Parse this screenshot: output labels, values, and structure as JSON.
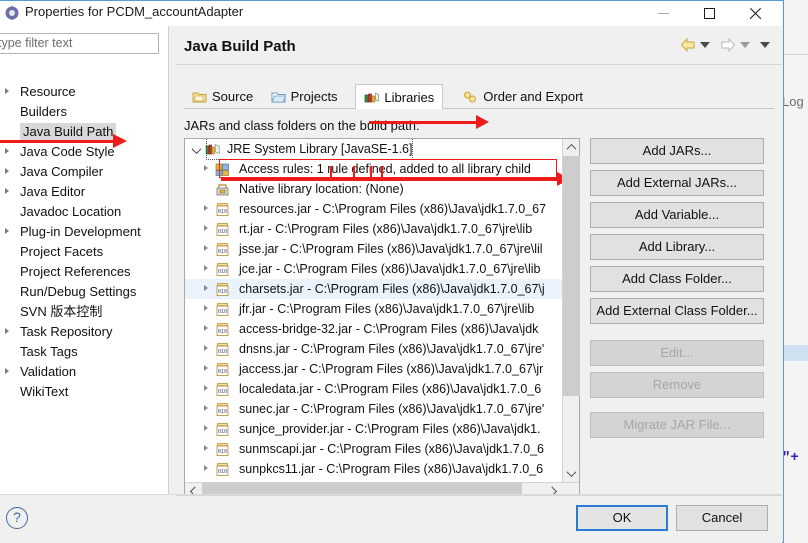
{
  "window": {
    "title": "Properties for PCDM_accountAdapter",
    "icon": "eclipse-properties-icon",
    "controls": {
      "minimize": "minimize-icon",
      "maximize": "maximize-icon",
      "close": "close-icon"
    }
  },
  "sidebar": {
    "filter": {
      "value": "",
      "placeholder": "type filter text"
    },
    "items": [
      {
        "label": "Resource",
        "expandable": true,
        "selected": false
      },
      {
        "label": "Builders",
        "expandable": false,
        "selected": false
      },
      {
        "label": "Java Build Path",
        "expandable": false,
        "selected": true
      },
      {
        "label": "Java Code Style",
        "expandable": true,
        "selected": false
      },
      {
        "label": "Java Compiler",
        "expandable": true,
        "selected": false
      },
      {
        "label": "Java Editor",
        "expandable": true,
        "selected": false
      },
      {
        "label": "Javadoc Location",
        "expandable": false,
        "selected": false
      },
      {
        "label": "Plug-in Development",
        "expandable": true,
        "selected": false
      },
      {
        "label": "Project Facets",
        "expandable": false,
        "selected": false
      },
      {
        "label": "Project References",
        "expandable": false,
        "selected": false
      },
      {
        "label": "Run/Debug Settings",
        "expandable": false,
        "selected": false
      },
      {
        "label": "SVN 版本控制",
        "expandable": false,
        "selected": false
      },
      {
        "label": "Task Repository",
        "expandable": true,
        "selected": false
      },
      {
        "label": "Task Tags",
        "expandable": false,
        "selected": false
      },
      {
        "label": "Validation",
        "expandable": true,
        "selected": false
      },
      {
        "label": "WikiText",
        "expandable": false,
        "selected": false
      }
    ]
  },
  "page": {
    "title": "Java Build Path",
    "nav": {
      "back_icon": "back-arrow-icon",
      "back_menu_icon": "chevron-down-icon",
      "forward_icon": "forward-arrow-icon",
      "forward_menu_icon": "chevron-down-icon",
      "menu_icon": "chevron-down-icon"
    },
    "tabs": [
      {
        "label": "Source",
        "icon": "source-folder-icon",
        "active": false
      },
      {
        "label": "Projects",
        "icon": "projects-folder-icon",
        "active": false
      },
      {
        "label": "Libraries",
        "icon": "libraries-books-icon",
        "active": true
      },
      {
        "label": "Order and Export",
        "icon": "order-export-icon",
        "active": false
      }
    ],
    "hint": "JARs and class folders on the build path:"
  },
  "tree": {
    "rows": [
      {
        "text": "JRE System Library [JavaSE-1.6]",
        "icon": "jre-library-icon",
        "expander": "down",
        "indent": 0,
        "hover": false,
        "focus": true
      },
      {
        "text": "Access rules: 1 rule defined, added to all library child",
        "icon": "access-rules-icon",
        "expander": "right",
        "indent": 1,
        "hover": false,
        "focus": false
      },
      {
        "text": "Native library location: (None)",
        "icon": "native-library-icon",
        "expander": "none",
        "indent": 1,
        "hover": false,
        "focus": false
      },
      {
        "text": "resources.jar - C:\\Program Files (x86)\\Java\\jdk1.7.0_67",
        "icon": "jar-icon",
        "expander": "right",
        "indent": 1,
        "hover": false,
        "focus": false
      },
      {
        "text": "rt.jar - C:\\Program Files (x86)\\Java\\jdk1.7.0_67\\jre\\lib",
        "icon": "jar-icon",
        "expander": "right",
        "indent": 1,
        "hover": false,
        "focus": false
      },
      {
        "text": "jsse.jar - C:\\Program Files (x86)\\Java\\jdk1.7.0_67\\jre\\lil",
        "icon": "jar-icon",
        "expander": "right",
        "indent": 1,
        "hover": false,
        "focus": false
      },
      {
        "text": "jce.jar - C:\\Program Files (x86)\\Java\\jdk1.7.0_67\\jre\\lib",
        "icon": "jar-icon",
        "expander": "right",
        "indent": 1,
        "hover": false,
        "focus": false
      },
      {
        "text": "charsets.jar - C:\\Program Files (x86)\\Java\\jdk1.7.0_67\\j",
        "icon": "jar-icon",
        "expander": "right",
        "indent": 1,
        "hover": true,
        "focus": false
      },
      {
        "text": "jfr.jar - C:\\Program Files (x86)\\Java\\jdk1.7.0_67\\jre\\lib",
        "icon": "jar-icon",
        "expander": "right",
        "indent": 1,
        "hover": false,
        "focus": false
      },
      {
        "text": "access-bridge-32.jar - C:\\Program Files (x86)\\Java\\jdk",
        "icon": "jar-icon",
        "expander": "right",
        "indent": 1,
        "hover": false,
        "focus": false
      },
      {
        "text": "dnsns.jar - C:\\Program Files (x86)\\Java\\jdk1.7.0_67\\jre'",
        "icon": "jar-icon",
        "expander": "right",
        "indent": 1,
        "hover": false,
        "focus": false
      },
      {
        "text": "jaccess.jar - C:\\Program Files (x86)\\Java\\jdk1.7.0_67\\jr",
        "icon": "jar-icon",
        "expander": "right",
        "indent": 1,
        "hover": false,
        "focus": false
      },
      {
        "text": "localedata.jar - C:\\Program Files (x86)\\Java\\jdk1.7.0_6",
        "icon": "jar-icon",
        "expander": "right",
        "indent": 1,
        "hover": false,
        "focus": false
      },
      {
        "text": "sunec.jar - C:\\Program Files (x86)\\Java\\jdk1.7.0_67\\jre'",
        "icon": "jar-icon",
        "expander": "right",
        "indent": 1,
        "hover": false,
        "focus": false
      },
      {
        "text": "sunjce_provider.jar - C:\\Program Files (x86)\\Java\\jdk1.",
        "icon": "jar-icon",
        "expander": "right",
        "indent": 1,
        "hover": false,
        "focus": false
      },
      {
        "text": "sunmscapi.jar - C:\\Program Files (x86)\\Java\\jdk1.7.0_6",
        "icon": "jar-icon",
        "expander": "right",
        "indent": 1,
        "hover": false,
        "focus": false
      },
      {
        "text": "sunpkcs11.jar - C:\\Program Files (x86)\\Java\\jdk1.7.0_6",
        "icon": "jar-icon",
        "expander": "right",
        "indent": 1,
        "hover": false,
        "focus": false
      }
    ],
    "scroll": {
      "vertical_up_icon": "chevron-up-icon",
      "vertical_down_icon": "chevron-down-icon",
      "horizontal_left_icon": "chevron-left-icon",
      "horizontal_right_icon": "chevron-right-icon"
    }
  },
  "buttons": [
    {
      "label": "Add JARs...",
      "enabled": true
    },
    {
      "label": "Add External JARs...",
      "enabled": true
    },
    {
      "label": "Add Variable...",
      "enabled": true
    },
    {
      "label": "Add Library...",
      "enabled": true
    },
    {
      "label": "Add Class Folder...",
      "enabled": true
    },
    {
      "label": "Add External Class Folder...",
      "enabled": true
    },
    {
      "label": "Edit...",
      "enabled": false
    },
    {
      "label": "Remove",
      "enabled": false
    },
    {
      "label": "Migrate JAR File...",
      "enabled": false
    }
  ],
  "footer": {
    "help_icon": "help-question-icon",
    "help_glyph": "?",
    "ok_label": "OK",
    "cancel_label": "Cancel"
  },
  "annotations": {
    "color": "#ee1b1b",
    "items": [
      {
        "type": "arrow",
        "target": "sidebar-item-java-build-path"
      },
      {
        "type": "arrow",
        "target": "tab-libraries"
      },
      {
        "type": "rectangle-arrow",
        "target": "tree-row-access-rules"
      }
    ]
  },
  "background": {
    "text_fragment": "Log",
    "quote_fragment": "\"+"
  }
}
